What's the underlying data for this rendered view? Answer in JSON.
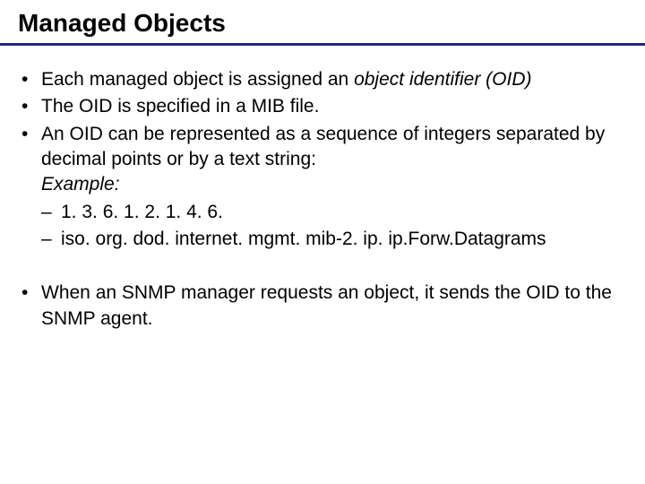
{
  "title": "Managed Objects",
  "b1_pre": "Each managed object is assigned an ",
  "b1_em": "object identifier (OID)",
  "b2": "The OID is specified in a MIB file.",
  "b3_line1": "An OID can be represented as a sequence of integers separated by decimal points or by a text string:",
  "b3_example_label": "Example:",
  "b3_sub1": "1. 3. 6. 1. 2. 1. 4. 6.",
  "b3_sub2": "iso. org. dod. internet. mgmt. mib-2. ip. ip.Forw.Datagrams",
  "b4": "When an SNMP manager requests an object, it sends the OID to the SNMP agent."
}
